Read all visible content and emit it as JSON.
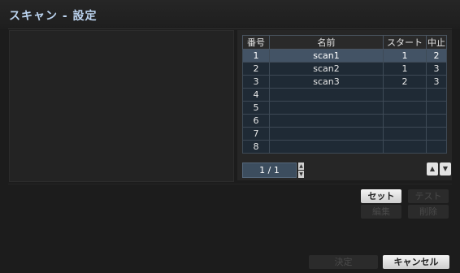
{
  "window": {
    "title": "スキャン - 設定"
  },
  "table": {
    "headers": [
      "番号",
      "名前",
      "スタート",
      "中止"
    ],
    "rows": [
      {
        "no": "1",
        "name": "scan1",
        "start": "1",
        "stop": "2"
      },
      {
        "no": "2",
        "name": "scan2",
        "start": "1",
        "stop": "3"
      },
      {
        "no": "3",
        "name": "scan3",
        "start": "2",
        "stop": "3"
      },
      {
        "no": "4",
        "name": "",
        "start": "",
        "stop": ""
      },
      {
        "no": "5",
        "name": "",
        "start": "",
        "stop": ""
      },
      {
        "no": "6",
        "name": "",
        "start": "",
        "stop": ""
      },
      {
        "no": "7",
        "name": "",
        "start": "",
        "stop": ""
      },
      {
        "no": "8",
        "name": "",
        "start": "",
        "stop": ""
      }
    ],
    "selected_row": 1
  },
  "pagination": {
    "label": "1 / 1"
  },
  "actions": {
    "set": "セット",
    "test": "テスト",
    "edit": "編集",
    "delete": "削除"
  },
  "footer": {
    "ok": "決定",
    "cancel": "キャンセル"
  },
  "icons": {
    "spin_up": "triangle-up",
    "spin_down": "triangle-down",
    "nav_up": "triangle-up",
    "nav_down": "triangle-down"
  }
}
